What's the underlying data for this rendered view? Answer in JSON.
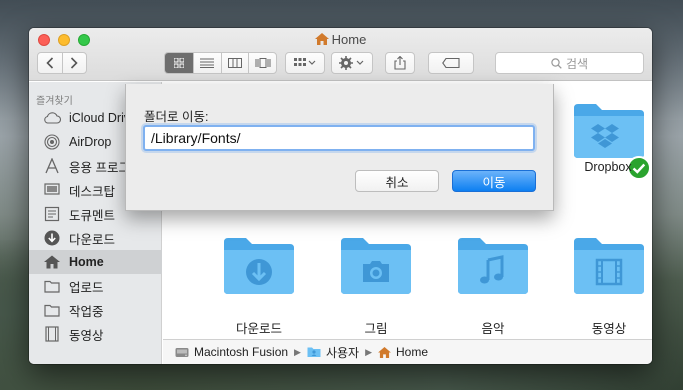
{
  "window": {
    "title": "Home"
  },
  "toolbar": {
    "back_icon": "chevron-left-icon",
    "forward_icon": "chevron-right-icon",
    "views": [
      "icon-view",
      "list-view",
      "column-view",
      "cover-flow-view"
    ],
    "search_placeholder": "검색"
  },
  "sidebar": {
    "header": "즐겨찾기",
    "items": [
      {
        "label": "iCloud Drive",
        "icon": "cloud-icon"
      },
      {
        "label": "AirDrop",
        "icon": "airdrop-icon"
      },
      {
        "label": "응용 프로그램",
        "icon": "applications-icon"
      },
      {
        "label": "데스크탑",
        "icon": "desktop-icon"
      },
      {
        "label": "도큐멘트",
        "icon": "document-icon"
      },
      {
        "label": "다운로드",
        "icon": "download-icon"
      },
      {
        "label": "Home",
        "icon": "home-icon",
        "active": true
      },
      {
        "label": "업로드",
        "icon": "folder-icon"
      },
      {
        "label": "작업중",
        "icon": "folder-icon"
      },
      {
        "label": "동영상",
        "icon": "movie-icon"
      }
    ]
  },
  "content": {
    "folders": [
      {
        "label": "Dropbox",
        "icon": "dropbox-folder-icon"
      },
      {
        "label": "다운로드",
        "icon": "download-folder-icon"
      },
      {
        "label": "그림",
        "icon": "pictures-folder-icon"
      },
      {
        "label": "음악",
        "icon": "music-folder-icon"
      },
      {
        "label": "동영상",
        "icon": "movies-folder-icon"
      }
    ]
  },
  "pathbar": {
    "items": [
      "Macintosh Fusion",
      "사용자",
      "Home"
    ]
  },
  "dialog": {
    "label": "폴더로 이동:",
    "value": "/Library/Fonts/",
    "cancel_label": "취소",
    "go_label": "이동"
  },
  "colors": {
    "folder": "#6cc0f4",
    "folder_dark": "#4aa8e8",
    "accent": "#0d7ff1",
    "sync_badge": "#2aa32e"
  }
}
